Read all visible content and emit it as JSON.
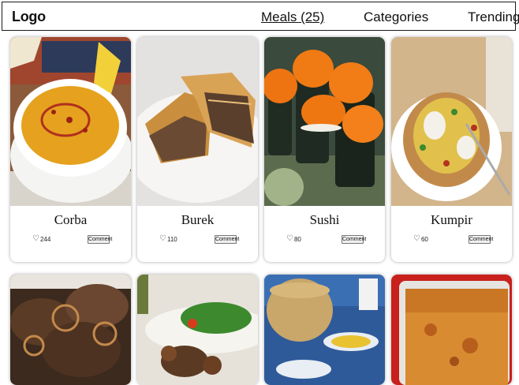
{
  "nav": {
    "logo": "Logo",
    "meals": "Meals (25)",
    "categories": "Categories",
    "trending": "Trending"
  },
  "meals": [
    {
      "name": "Corba",
      "likes": "244",
      "comment": "Comment"
    },
    {
      "name": "Burek",
      "likes": "110",
      "comment": "Comment"
    },
    {
      "name": "Sushi",
      "likes": "80",
      "comment": "Comment"
    },
    {
      "name": "Kumpir",
      "likes": "60",
      "comment": "Comment"
    }
  ],
  "colors": {
    "border": "#1a1a1a",
    "card_shadow": "rgba(0,0,0,0.35)",
    "text": "#111111"
  }
}
